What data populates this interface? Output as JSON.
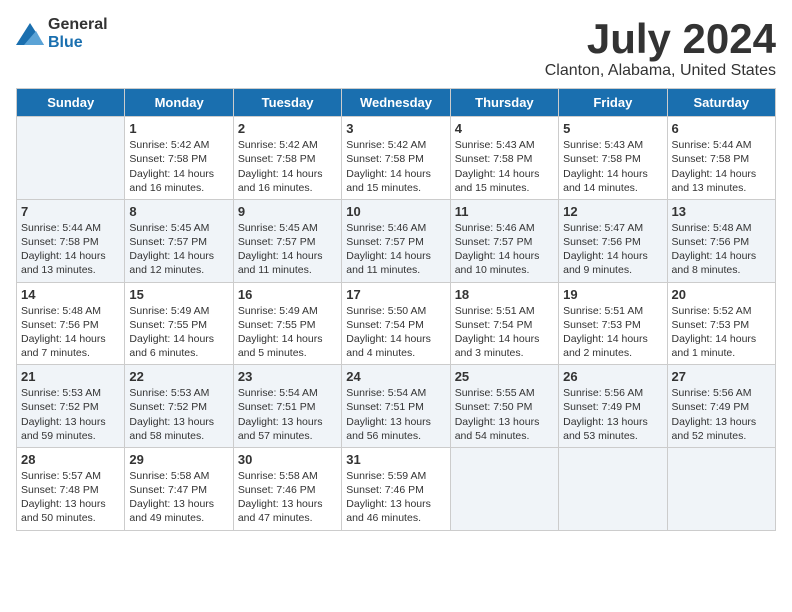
{
  "header": {
    "logo_general": "General",
    "logo_blue": "Blue",
    "title": "July 2024",
    "subtitle": "Clanton, Alabama, United States"
  },
  "days_of_week": [
    "Sunday",
    "Monday",
    "Tuesday",
    "Wednesday",
    "Thursday",
    "Friday",
    "Saturday"
  ],
  "weeks": [
    [
      {
        "day": "",
        "empty": true
      },
      {
        "day": "1",
        "sunrise": "Sunrise: 5:42 AM",
        "sunset": "Sunset: 7:58 PM",
        "daylight": "Daylight: 14 hours and 16 minutes."
      },
      {
        "day": "2",
        "sunrise": "Sunrise: 5:42 AM",
        "sunset": "Sunset: 7:58 PM",
        "daylight": "Daylight: 14 hours and 16 minutes."
      },
      {
        "day": "3",
        "sunrise": "Sunrise: 5:42 AM",
        "sunset": "Sunset: 7:58 PM",
        "daylight": "Daylight: 14 hours and 15 minutes."
      },
      {
        "day": "4",
        "sunrise": "Sunrise: 5:43 AM",
        "sunset": "Sunset: 7:58 PM",
        "daylight": "Daylight: 14 hours and 15 minutes."
      },
      {
        "day": "5",
        "sunrise": "Sunrise: 5:43 AM",
        "sunset": "Sunset: 7:58 PM",
        "daylight": "Daylight: 14 hours and 14 minutes."
      },
      {
        "day": "6",
        "sunrise": "Sunrise: 5:44 AM",
        "sunset": "Sunset: 7:58 PM",
        "daylight": "Daylight: 14 hours and 13 minutes."
      }
    ],
    [
      {
        "day": "7",
        "sunrise": "Sunrise: 5:44 AM",
        "sunset": "Sunset: 7:58 PM",
        "daylight": "Daylight: 14 hours and 13 minutes."
      },
      {
        "day": "8",
        "sunrise": "Sunrise: 5:45 AM",
        "sunset": "Sunset: 7:57 PM",
        "daylight": "Daylight: 14 hours and 12 minutes."
      },
      {
        "day": "9",
        "sunrise": "Sunrise: 5:45 AM",
        "sunset": "Sunset: 7:57 PM",
        "daylight": "Daylight: 14 hours and 11 minutes."
      },
      {
        "day": "10",
        "sunrise": "Sunrise: 5:46 AM",
        "sunset": "Sunset: 7:57 PM",
        "daylight": "Daylight: 14 hours and 11 minutes."
      },
      {
        "day": "11",
        "sunrise": "Sunrise: 5:46 AM",
        "sunset": "Sunset: 7:57 PM",
        "daylight": "Daylight: 14 hours and 10 minutes."
      },
      {
        "day": "12",
        "sunrise": "Sunrise: 5:47 AM",
        "sunset": "Sunset: 7:56 PM",
        "daylight": "Daylight: 14 hours and 9 minutes."
      },
      {
        "day": "13",
        "sunrise": "Sunrise: 5:48 AM",
        "sunset": "Sunset: 7:56 PM",
        "daylight": "Daylight: 14 hours and 8 minutes."
      }
    ],
    [
      {
        "day": "14",
        "sunrise": "Sunrise: 5:48 AM",
        "sunset": "Sunset: 7:56 PM",
        "daylight": "Daylight: 14 hours and 7 minutes."
      },
      {
        "day": "15",
        "sunrise": "Sunrise: 5:49 AM",
        "sunset": "Sunset: 7:55 PM",
        "daylight": "Daylight: 14 hours and 6 minutes."
      },
      {
        "day": "16",
        "sunrise": "Sunrise: 5:49 AM",
        "sunset": "Sunset: 7:55 PM",
        "daylight": "Daylight: 14 hours and 5 minutes."
      },
      {
        "day": "17",
        "sunrise": "Sunrise: 5:50 AM",
        "sunset": "Sunset: 7:54 PM",
        "daylight": "Daylight: 14 hours and 4 minutes."
      },
      {
        "day": "18",
        "sunrise": "Sunrise: 5:51 AM",
        "sunset": "Sunset: 7:54 PM",
        "daylight": "Daylight: 14 hours and 3 minutes."
      },
      {
        "day": "19",
        "sunrise": "Sunrise: 5:51 AM",
        "sunset": "Sunset: 7:53 PM",
        "daylight": "Daylight: 14 hours and 2 minutes."
      },
      {
        "day": "20",
        "sunrise": "Sunrise: 5:52 AM",
        "sunset": "Sunset: 7:53 PM",
        "daylight": "Daylight: 14 hours and 1 minute."
      }
    ],
    [
      {
        "day": "21",
        "sunrise": "Sunrise: 5:53 AM",
        "sunset": "Sunset: 7:52 PM",
        "daylight": "Daylight: 13 hours and 59 minutes."
      },
      {
        "day": "22",
        "sunrise": "Sunrise: 5:53 AM",
        "sunset": "Sunset: 7:52 PM",
        "daylight": "Daylight: 13 hours and 58 minutes."
      },
      {
        "day": "23",
        "sunrise": "Sunrise: 5:54 AM",
        "sunset": "Sunset: 7:51 PM",
        "daylight": "Daylight: 13 hours and 57 minutes."
      },
      {
        "day": "24",
        "sunrise": "Sunrise: 5:54 AM",
        "sunset": "Sunset: 7:51 PM",
        "daylight": "Daylight: 13 hours and 56 minutes."
      },
      {
        "day": "25",
        "sunrise": "Sunrise: 5:55 AM",
        "sunset": "Sunset: 7:50 PM",
        "daylight": "Daylight: 13 hours and 54 minutes."
      },
      {
        "day": "26",
        "sunrise": "Sunrise: 5:56 AM",
        "sunset": "Sunset: 7:49 PM",
        "daylight": "Daylight: 13 hours and 53 minutes."
      },
      {
        "day": "27",
        "sunrise": "Sunrise: 5:56 AM",
        "sunset": "Sunset: 7:49 PM",
        "daylight": "Daylight: 13 hours and 52 minutes."
      }
    ],
    [
      {
        "day": "28",
        "sunrise": "Sunrise: 5:57 AM",
        "sunset": "Sunset: 7:48 PM",
        "daylight": "Daylight: 13 hours and 50 minutes."
      },
      {
        "day": "29",
        "sunrise": "Sunrise: 5:58 AM",
        "sunset": "Sunset: 7:47 PM",
        "daylight": "Daylight: 13 hours and 49 minutes."
      },
      {
        "day": "30",
        "sunrise": "Sunrise: 5:58 AM",
        "sunset": "Sunset: 7:46 PM",
        "daylight": "Daylight: 13 hours and 47 minutes."
      },
      {
        "day": "31",
        "sunrise": "Sunrise: 5:59 AM",
        "sunset": "Sunset: 7:46 PM",
        "daylight": "Daylight: 13 hours and 46 minutes."
      },
      {
        "day": "",
        "empty": true
      },
      {
        "day": "",
        "empty": true
      },
      {
        "day": "",
        "empty": true
      }
    ]
  ]
}
